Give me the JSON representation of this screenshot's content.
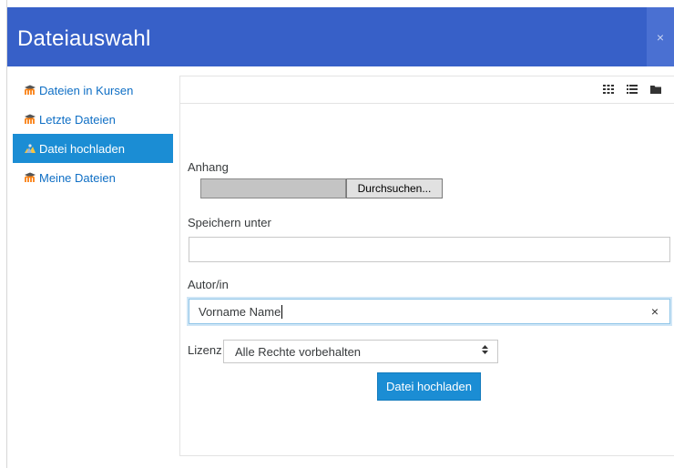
{
  "dialog": {
    "title": "Dateiauswahl",
    "close_label": "×"
  },
  "sidebar": {
    "items": [
      {
        "label": "Dateien in Kursen",
        "icon": "moodle-icon",
        "active": false
      },
      {
        "label": "Letzte Dateien",
        "icon": "moodle-icon",
        "active": false
      },
      {
        "label": "Datei hochladen",
        "icon": "upload-icon",
        "active": true
      },
      {
        "label": "Meine Dateien",
        "icon": "moodle-icon",
        "active": false
      }
    ]
  },
  "toolbar": {
    "views": [
      "grid-view-icon",
      "list-view-icon",
      "folder-view-icon"
    ]
  },
  "form": {
    "attachment_label": "Anhang",
    "browse_label": "Durchsuchen...",
    "save_as_label": "Speichern unter",
    "save_as_value": "",
    "author_label": "Autor/in",
    "author_value": "Vorname Name",
    "clear_label": "×",
    "license_label": "Lizenz",
    "license_value": "Alle Rechte vorbehalten",
    "submit_label": "Datei hochladen"
  },
  "colors": {
    "header": "#3760c8",
    "accent": "#1b8dd4",
    "link": "#0f6fc5"
  }
}
